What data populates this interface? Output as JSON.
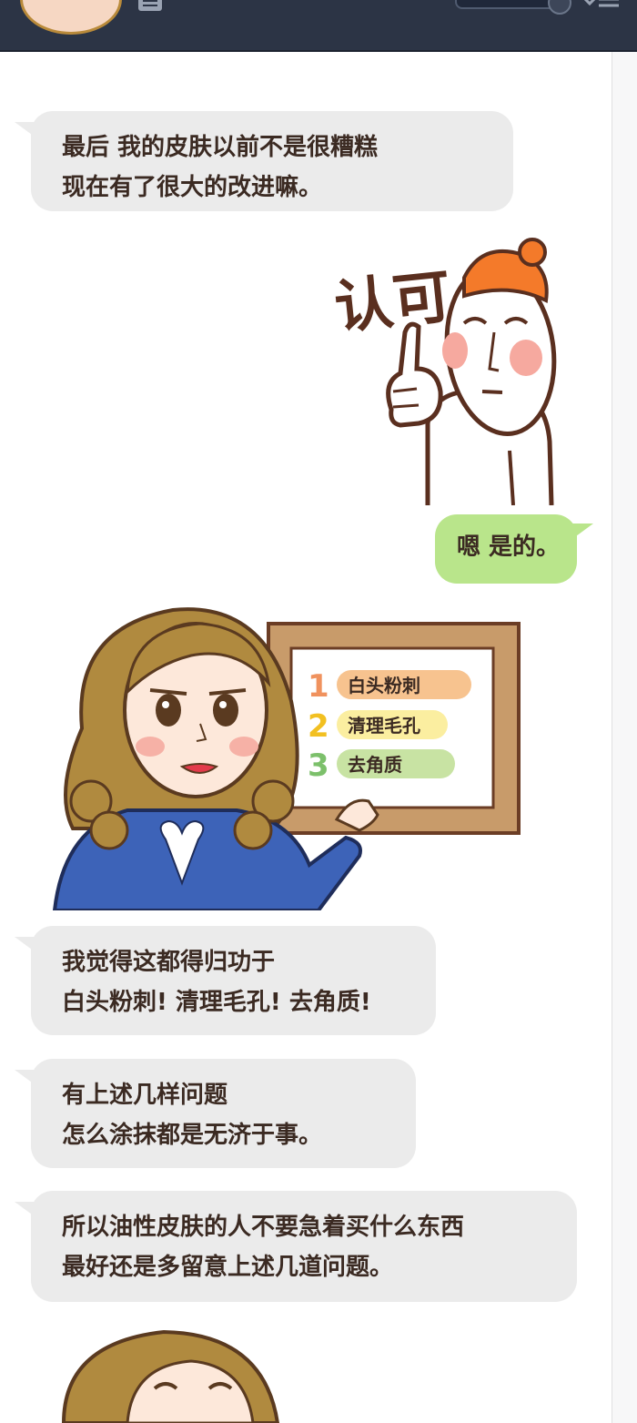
{
  "chat": {
    "messages": [
      {
        "lines": [
          "最后 我的皮肤以前不是很糟糕",
          "现在有了很大的改进嘛。"
        ]
      },
      {
        "lines": [
          "嗯 是的。"
        ]
      },
      {
        "lines": [
          "我觉得这都得归功于",
          "白头粉刺! 清理毛孔! 去角质!"
        ]
      },
      {
        "lines": [
          "有上述几样问题",
          "怎么涂抹都是无济于事。"
        ]
      },
      {
        "lines": [
          "所以油性皮肤的人不要急着买什么东西",
          "最好还是多留意上述几道问题。"
        ]
      }
    ]
  },
  "sticker": {
    "text": "认可"
  },
  "board": {
    "items": [
      {
        "num": "1",
        "label": "白头粉刺",
        "num_color": "#f0925e",
        "pill_color": "#f7c38f"
      },
      {
        "num": "2",
        "label": "清理毛孔",
        "num_color": "#f2c021",
        "pill_color": "#fbeea0"
      },
      {
        "num": "3",
        "label": "去角质",
        "num_color": "#7cc06b",
        "pill_color": "#c8e3a3"
      }
    ]
  },
  "colors": {
    "bubble_gray": "#ebebeb",
    "bubble_green": "#b9e58b",
    "text": "#3b2a22",
    "topbar": "#2c3445"
  }
}
